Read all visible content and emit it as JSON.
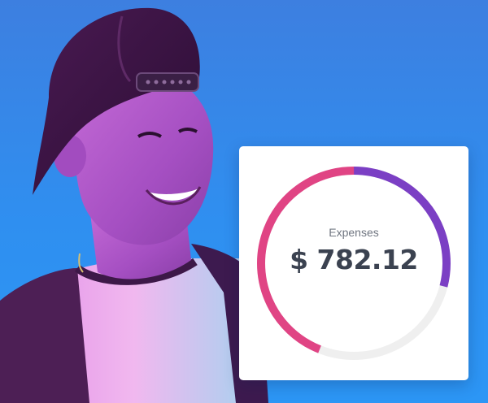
{
  "expense_card": {
    "label": "Expenses",
    "amount": "$ 782.12",
    "ring": {
      "track_color": "#efefef",
      "segments": [
        {
          "color": "#7b3fc4",
          "fraction": 0.29
        },
        {
          "color": "#e04484",
          "fraction": 0.44
        }
      ]
    }
  }
}
